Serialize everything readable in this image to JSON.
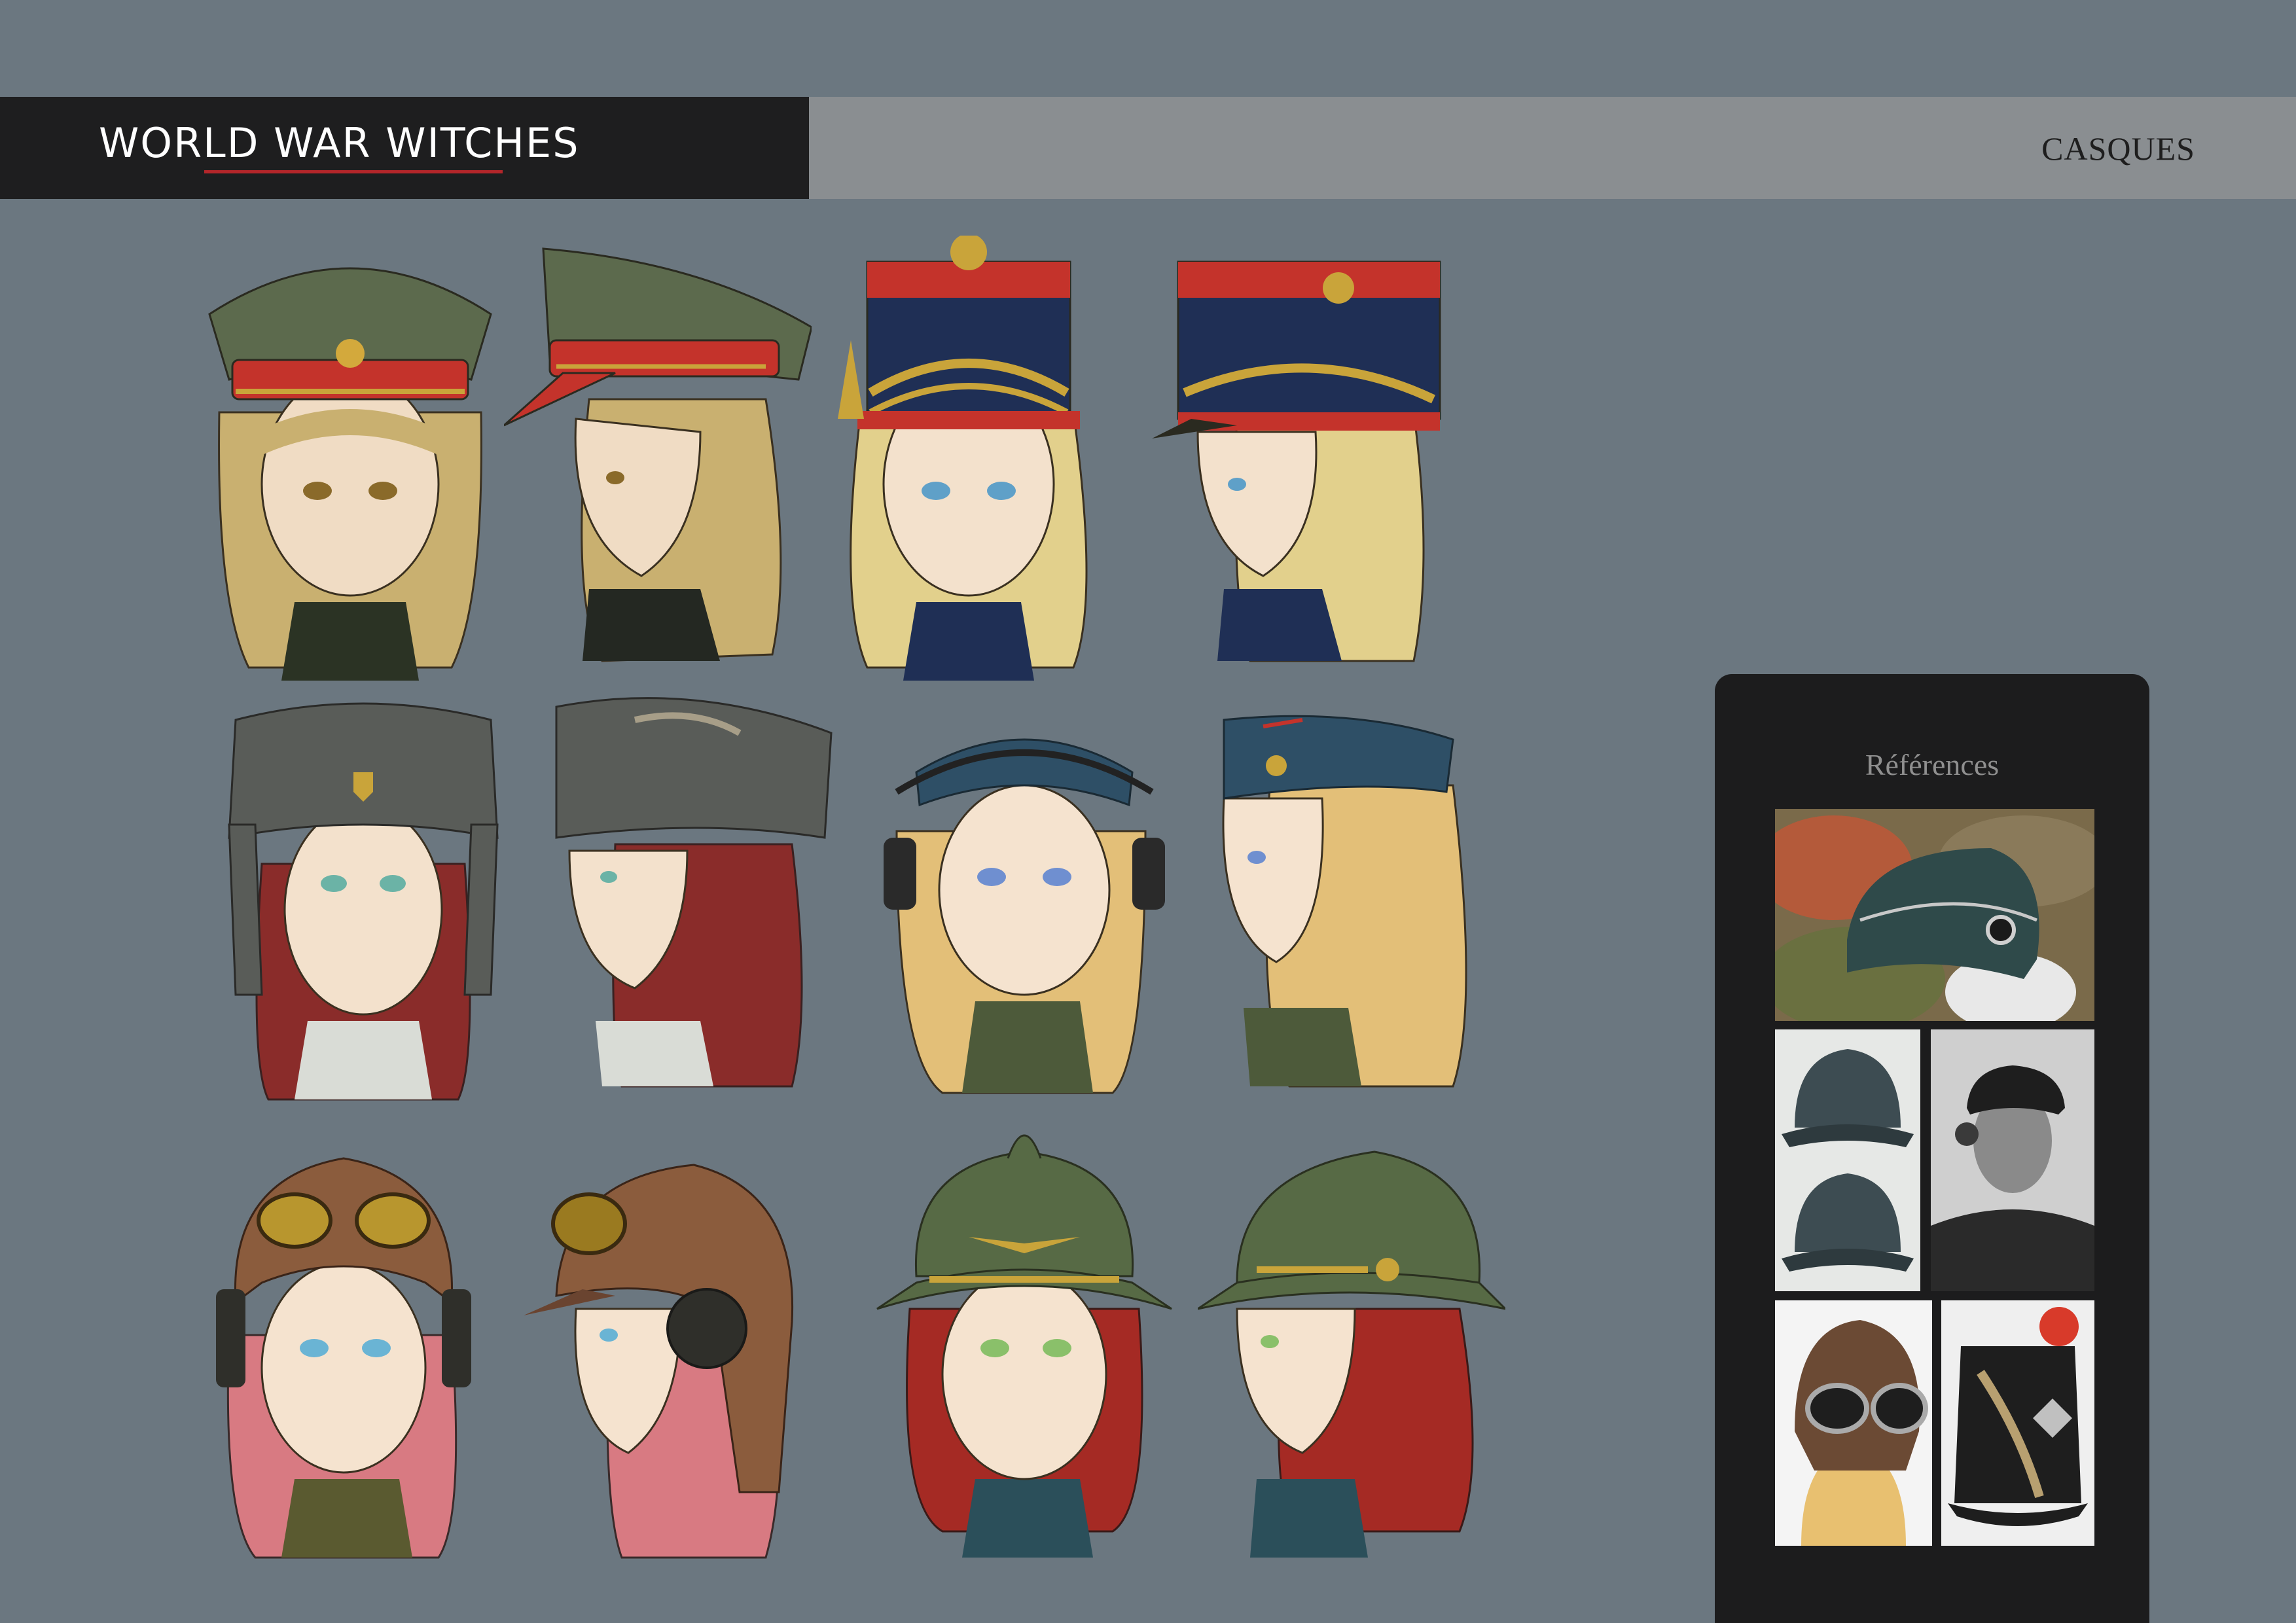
{
  "header": {
    "title": "WORLD WAR WITCHES",
    "section": "CASQUES"
  },
  "references": {
    "title": "Références"
  },
  "colors": {
    "background": "#6b7780",
    "header_dark": "#1e1e1f",
    "header_light": "#8a8e91",
    "accent_red": "#b3262a",
    "panel": "#1c1c1d"
  },
  "figures": [
    {
      "headwear": "officer-peaked-cap-front",
      "hair": "#c9b070",
      "hat": "#5c6a4d",
      "band": "#c4332b"
    },
    {
      "headwear": "officer-peaked-cap-side",
      "hair": "#c9b070",
      "hat": "#5c6a4d",
      "band": "#c4332b"
    },
    {
      "headwear": "shako-front",
      "hair": "#e2d08c",
      "hat": "#1f2f55",
      "band": "#c4332b"
    },
    {
      "headwear": "shako-side",
      "hair": "#e2d08c",
      "hat": "#1f2f55",
      "band": "#c4332b"
    },
    {
      "headwear": "ushanka-front",
      "hair": "#8a2c2a",
      "hat": "#595c58",
      "band": "#595c58"
    },
    {
      "headwear": "ushanka-side",
      "hair": "#8a2c2a",
      "hat": "#595c58",
      "band": "#595c58"
    },
    {
      "headwear": "garrison-cap-headset-front",
      "hair": "#e3bf78",
      "hat": "#2e4f66",
      "band": "#2e4f66"
    },
    {
      "headwear": "garrison-cap-side",
      "hair": "#e3bf78",
      "hat": "#2e4f66",
      "band": "#2e4f66"
    },
    {
      "headwear": "aviator-helmet-front",
      "hair": "#d87a82",
      "hat": "#8b5c3d",
      "band": "#8b5c3d"
    },
    {
      "headwear": "aviator-helmet-side",
      "hair": "#d87a82",
      "hat": "#8b5c3d",
      "band": "#8b5c3d"
    },
    {
      "headwear": "adrian-helmet-front",
      "hair": "#a52a24",
      "hat": "#576a45",
      "band": "#576a45"
    },
    {
      "headwear": "adrian-helmet-side",
      "hair": "#a52a24",
      "hat": "#576a45",
      "band": "#576a45"
    }
  ]
}
